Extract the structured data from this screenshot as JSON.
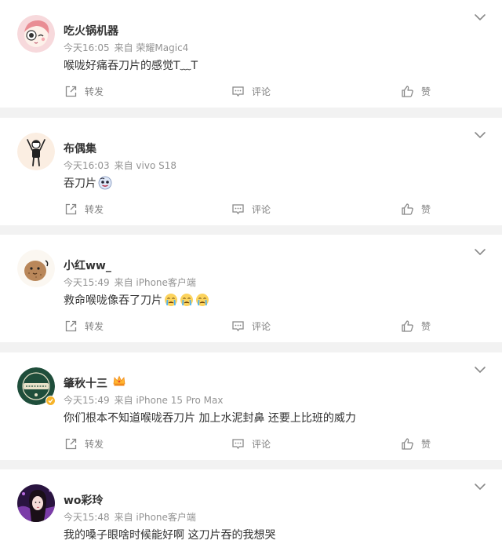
{
  "comments": [
    {
      "username": "吃火锅机器",
      "time": "今天16:05",
      "source": "来自 荣耀Magic4",
      "text": "喉咙好痛吞刀片的感觉T﹏T",
      "emojis": [],
      "avatar": "cartoon-girl-avatar",
      "badge": ""
    },
    {
      "username": "布偶集",
      "time": "今天16:03",
      "source": "来自 vivo S18",
      "text": "吞刀片",
      "emojis": [
        "doge-emoji"
      ],
      "avatar": "stick-figure-avatar",
      "badge": ""
    },
    {
      "username": "小红ww_",
      "time": "今天15:49",
      "source": "来自 iPhone客户端",
      "text": "救命喉咙像吞了刀片",
      "emojis": [
        "crying-emoji",
        "crying-emoji",
        "crying-emoji"
      ],
      "avatar": "potato-avatar",
      "badge": ""
    },
    {
      "username": "肇秋十三",
      "time": "今天15:49",
      "source": "来自 iPhone 15 Pro Max",
      "text": "你们根本不知道喉咙吞刀片 加上水泥封鼻 还要上比班的威力",
      "emojis": [],
      "avatar": "green-badge-avatar",
      "badge": "crown-icon"
    },
    {
      "username": "wo彩玲",
      "time": "今天15:48",
      "source": "来自 iPhone客户端",
      "text": "我的嗓子眼啥时候能好啊 这刀片吞的我想哭",
      "emojis": [],
      "avatar": "girl-photo-avatar",
      "badge": ""
    }
  ],
  "actions": {
    "share": "转发",
    "comment": "评论",
    "like": "赞"
  },
  "colors": {
    "page_bg": "#f2f2f2",
    "card_bg": "#ffffff",
    "name": "#333333",
    "meta": "#939393",
    "action": "#808080"
  }
}
